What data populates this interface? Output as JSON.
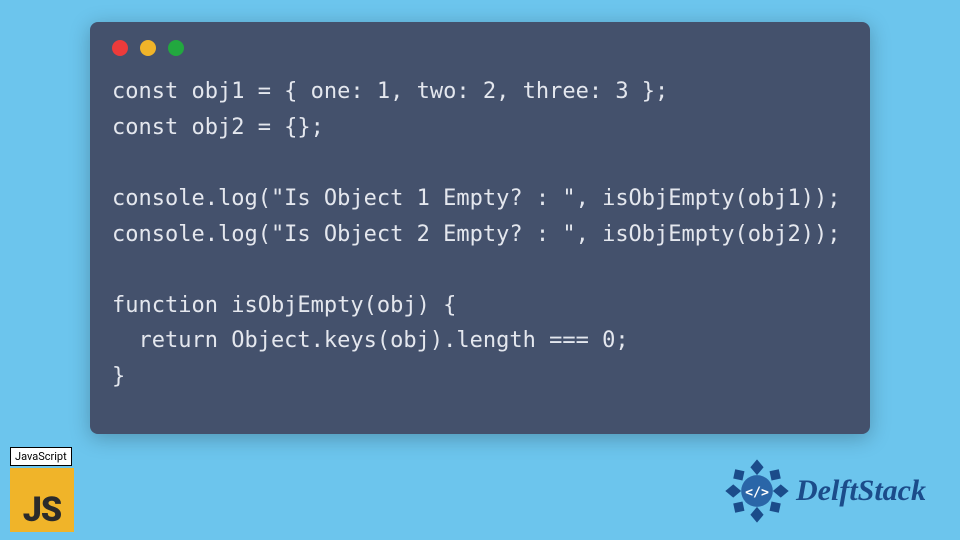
{
  "code": {
    "lines": [
      "const obj1 = { one: 1, two: 2, three: 3 };",
      "const obj2 = {};",
      "",
      "console.log(\"Is Object 1 Empty? : \", isObjEmpty(obj1));",
      "console.log(\"Is Object 2 Empty? : \", isObjEmpty(obj2));",
      "",
      "function isObjEmpty(obj) {",
      "  return Object.keys(obj).length === 0;",
      "}"
    ]
  },
  "badge": {
    "language_label": "JavaScript",
    "logo_text": "JS"
  },
  "brand": {
    "name": "DelftStack",
    "tag_symbol": "</>"
  },
  "colors": {
    "page_bg": "#6cc5ed",
    "window_bg": "#44516c",
    "code_fg": "#e4e7ee",
    "dot_red": "#ed3b3b",
    "dot_yellow": "#f0b429",
    "dot_green": "#22a83f",
    "js_bg": "#f0b429",
    "brand_color": "#1b4c8a"
  }
}
